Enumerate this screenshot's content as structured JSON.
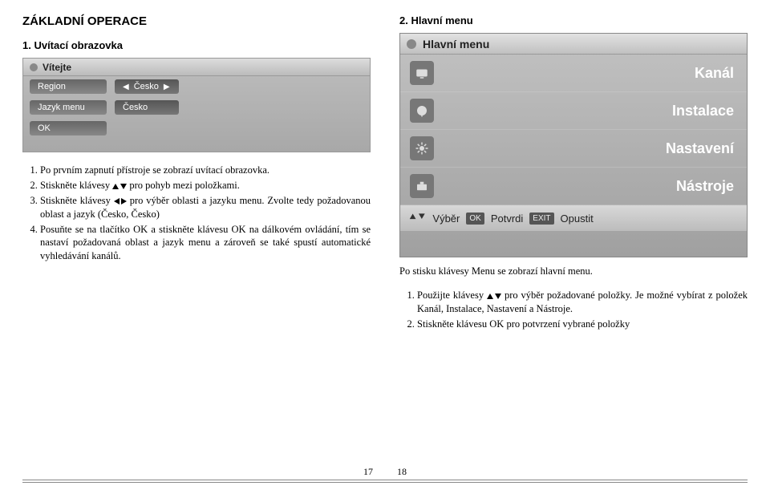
{
  "left": {
    "heading": "ZÁKLADNÍ OPERACE",
    "sub": "1. Uvítací obrazovka",
    "shot1": {
      "title": "Vítejte",
      "row1_label": "Region",
      "row1_value": "Česko",
      "row2_label": "Jazyk menu",
      "row2_value": "Česko",
      "row3_label": "OK"
    },
    "step1": "Po prvním zapnutí přístroje se zobrazí uvítací obrazovka.",
    "step2": "Stiskněte klávesy",
    "step2b": "pro pohyb mezi položkami.",
    "step3": "Stiskněte klávesy",
    "step3b": "pro výběr oblasti a jazyku menu. Zvolte tedy požadovanou oblast a jazyk (Česko, Česko)",
    "step4": "Posuňte se na tlačítko OK a stiskněte klávesu OK na dálkovém ovládání, tím se nastaví požadovaná oblast a jazyk menu a zároveň se také spustí automatické vyhledávání kanálů."
  },
  "right": {
    "heading": "2. Hlavní menu",
    "shot2": {
      "title": "Hlavní menu",
      "items": [
        {
          "label": "Kanál"
        },
        {
          "label": "Instalace"
        },
        {
          "label": "Nastavení"
        },
        {
          "label": "Nástroje"
        }
      ],
      "footer": {
        "vyber": "Výběr",
        "ok_key": "OK",
        "potvrdi": "Potvrdi",
        "exit_key": "EXIT",
        "opustit": "Opustit"
      }
    },
    "para": "Po stisku klávesy Menu se zobrazí hlavní menu.",
    "step1": "Použijte klávesy",
    "step1b": "pro výběr požadované položky. Je možné vybírat z položek Kanál, Instalace, Nastavení a Nástroje.",
    "step2": "Stiskněte klávesu OK pro potvrzení vybrané položky"
  },
  "pagenums": {
    "left": "17",
    "right": "18"
  }
}
